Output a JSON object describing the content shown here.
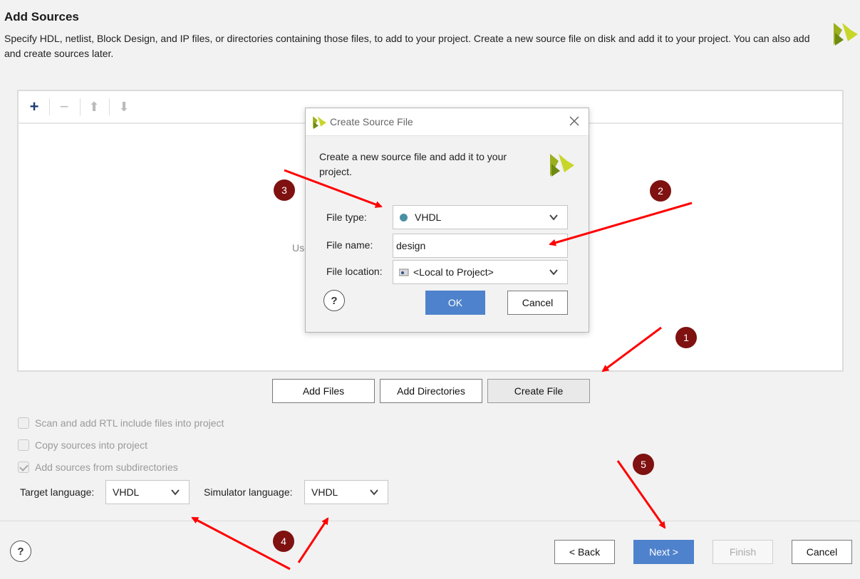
{
  "page": {
    "title": "Add Sources",
    "description": "Specify HDL, netlist, Block Design, and IP files, or directories containing those files, to add to your project. Create a new source file on disk and add it to your project. You can also add and create sources later."
  },
  "toolbar": {
    "add_icon": "plus-icon",
    "remove_icon": "minus-icon",
    "up_icon": "arrow-up-icon",
    "down_icon": "arrow-down-icon"
  },
  "sources_panel": {
    "hint_text": "Use"
  },
  "source_buttons": {
    "add_files": "Add Files",
    "add_directories": "Add Directories",
    "create_file": "Create File"
  },
  "options": {
    "scan_rtl": {
      "label": "Scan and add RTL include files into project",
      "checked": false
    },
    "copy_sources": {
      "label": "Copy sources into project",
      "checked": false
    },
    "add_subdirs": {
      "label": "Add sources from subdirectories",
      "checked": true
    }
  },
  "languages": {
    "target_label": "Target language:",
    "target_value": "VHDL",
    "simulator_label": "Simulator language:",
    "simulator_value": "VHDL"
  },
  "footer": {
    "help": "?",
    "back": "< Back",
    "next": "Next >",
    "finish": "Finish",
    "cancel": "Cancel"
  },
  "dialog": {
    "title": "Create Source File",
    "description": "Create a new source file and add it to your project.",
    "file_type_label": "File type:",
    "file_type_value": "VHDL",
    "file_name_label": "File name:",
    "file_name_value": "design",
    "file_location_label": "File location:",
    "file_location_value": "<Local to Project>",
    "help": "?",
    "ok": "OK",
    "cancel": "Cancel"
  },
  "annotations": [
    "1",
    "2",
    "3",
    "4",
    "5"
  ],
  "colors": {
    "accent": "#4f82cc",
    "badge": "#7f1111",
    "arrow": "#ff0000",
    "logo": "#9ab01e"
  }
}
